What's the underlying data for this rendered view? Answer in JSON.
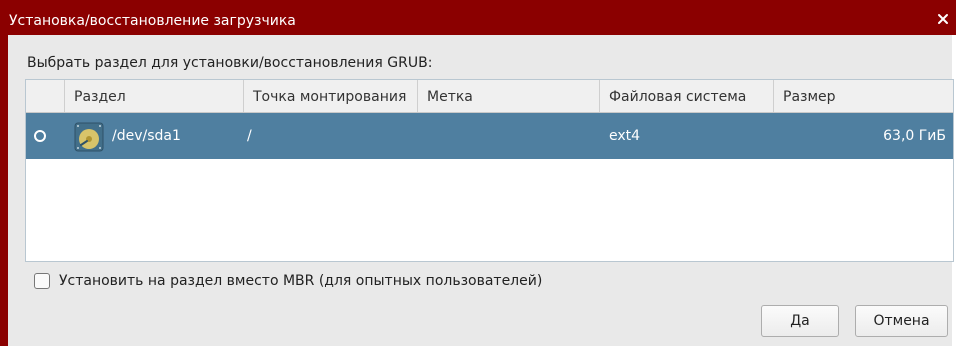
{
  "window": {
    "title": "Установка/восстановление загрузчика",
    "close_icon": "close-icon"
  },
  "prompt": "Выбрать раздел для установки/восстановления GRUB:",
  "table": {
    "columns": [
      "",
      "Раздел",
      "Точка монтирования",
      "Метка",
      "Файловая система",
      "Размер"
    ],
    "rows": [
      {
        "selected": true,
        "icon": "hard-drive-icon",
        "partition": "/dev/sda1",
        "mount_point": "/",
        "label": "",
        "filesystem": "ext4",
        "size": "63,0 ГиБ"
      }
    ]
  },
  "checkbox": {
    "label": "Установить на раздел вместо MBR (для опытных пользователей)",
    "checked": false
  },
  "buttons": {
    "ok": "Да",
    "cancel": "Отмена"
  },
  "colors": {
    "titlebar": "#8b0000",
    "selection": "#4f7fa0"
  }
}
